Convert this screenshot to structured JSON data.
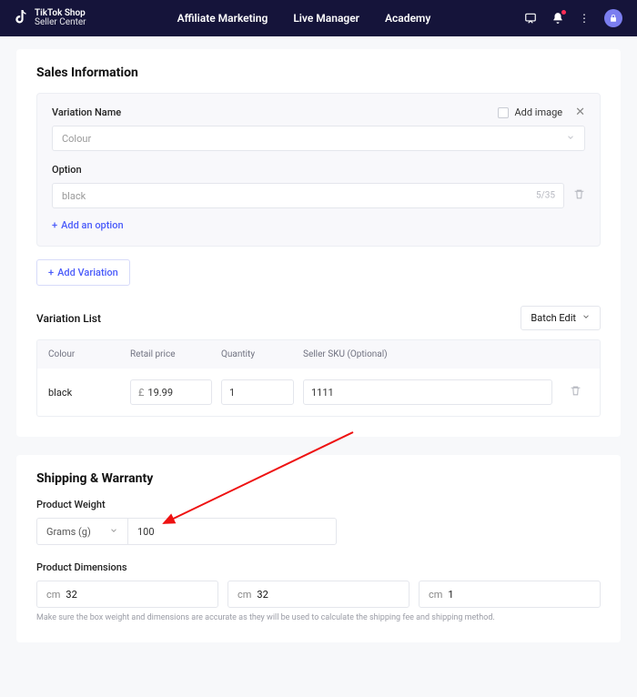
{
  "brand": {
    "line1": "TikTok Shop",
    "line2": "Seller Center"
  },
  "nav": {
    "affiliate": "Affiliate Marketing",
    "live": "Live Manager",
    "academy": "Academy"
  },
  "sales": {
    "heading": "Sales Information",
    "variation_name_label": "Variation Name",
    "add_image_label": "Add image",
    "variation_select_value": "Colour",
    "option_label": "Option",
    "option_value": "black",
    "option_count": "5/35",
    "add_option": "Add an option",
    "add_variation": "Add Variation",
    "variation_list_label": "Variation List",
    "batch_edit": "Batch Edit",
    "table": {
      "headers": {
        "colour": "Colour",
        "price": "Retail price",
        "qty": "Quantity",
        "sku": "Seller SKU (Optional)"
      },
      "row": {
        "colour": "black",
        "currency": "£",
        "price": "19.99",
        "qty": "1",
        "sku": "1111"
      }
    }
  },
  "shipping": {
    "heading": "Shipping & Warranty",
    "weight_label": "Product Weight",
    "weight_unit": "Grams (g)",
    "weight_value": "100",
    "dims_label": "Product Dimensions",
    "dim_unit": "cm",
    "dims": {
      "l": "32",
      "w": "32",
      "h": "1"
    },
    "hint": "Make sure the box weight and dimensions are accurate as they will be used to calculate the shipping fee and shipping method."
  }
}
